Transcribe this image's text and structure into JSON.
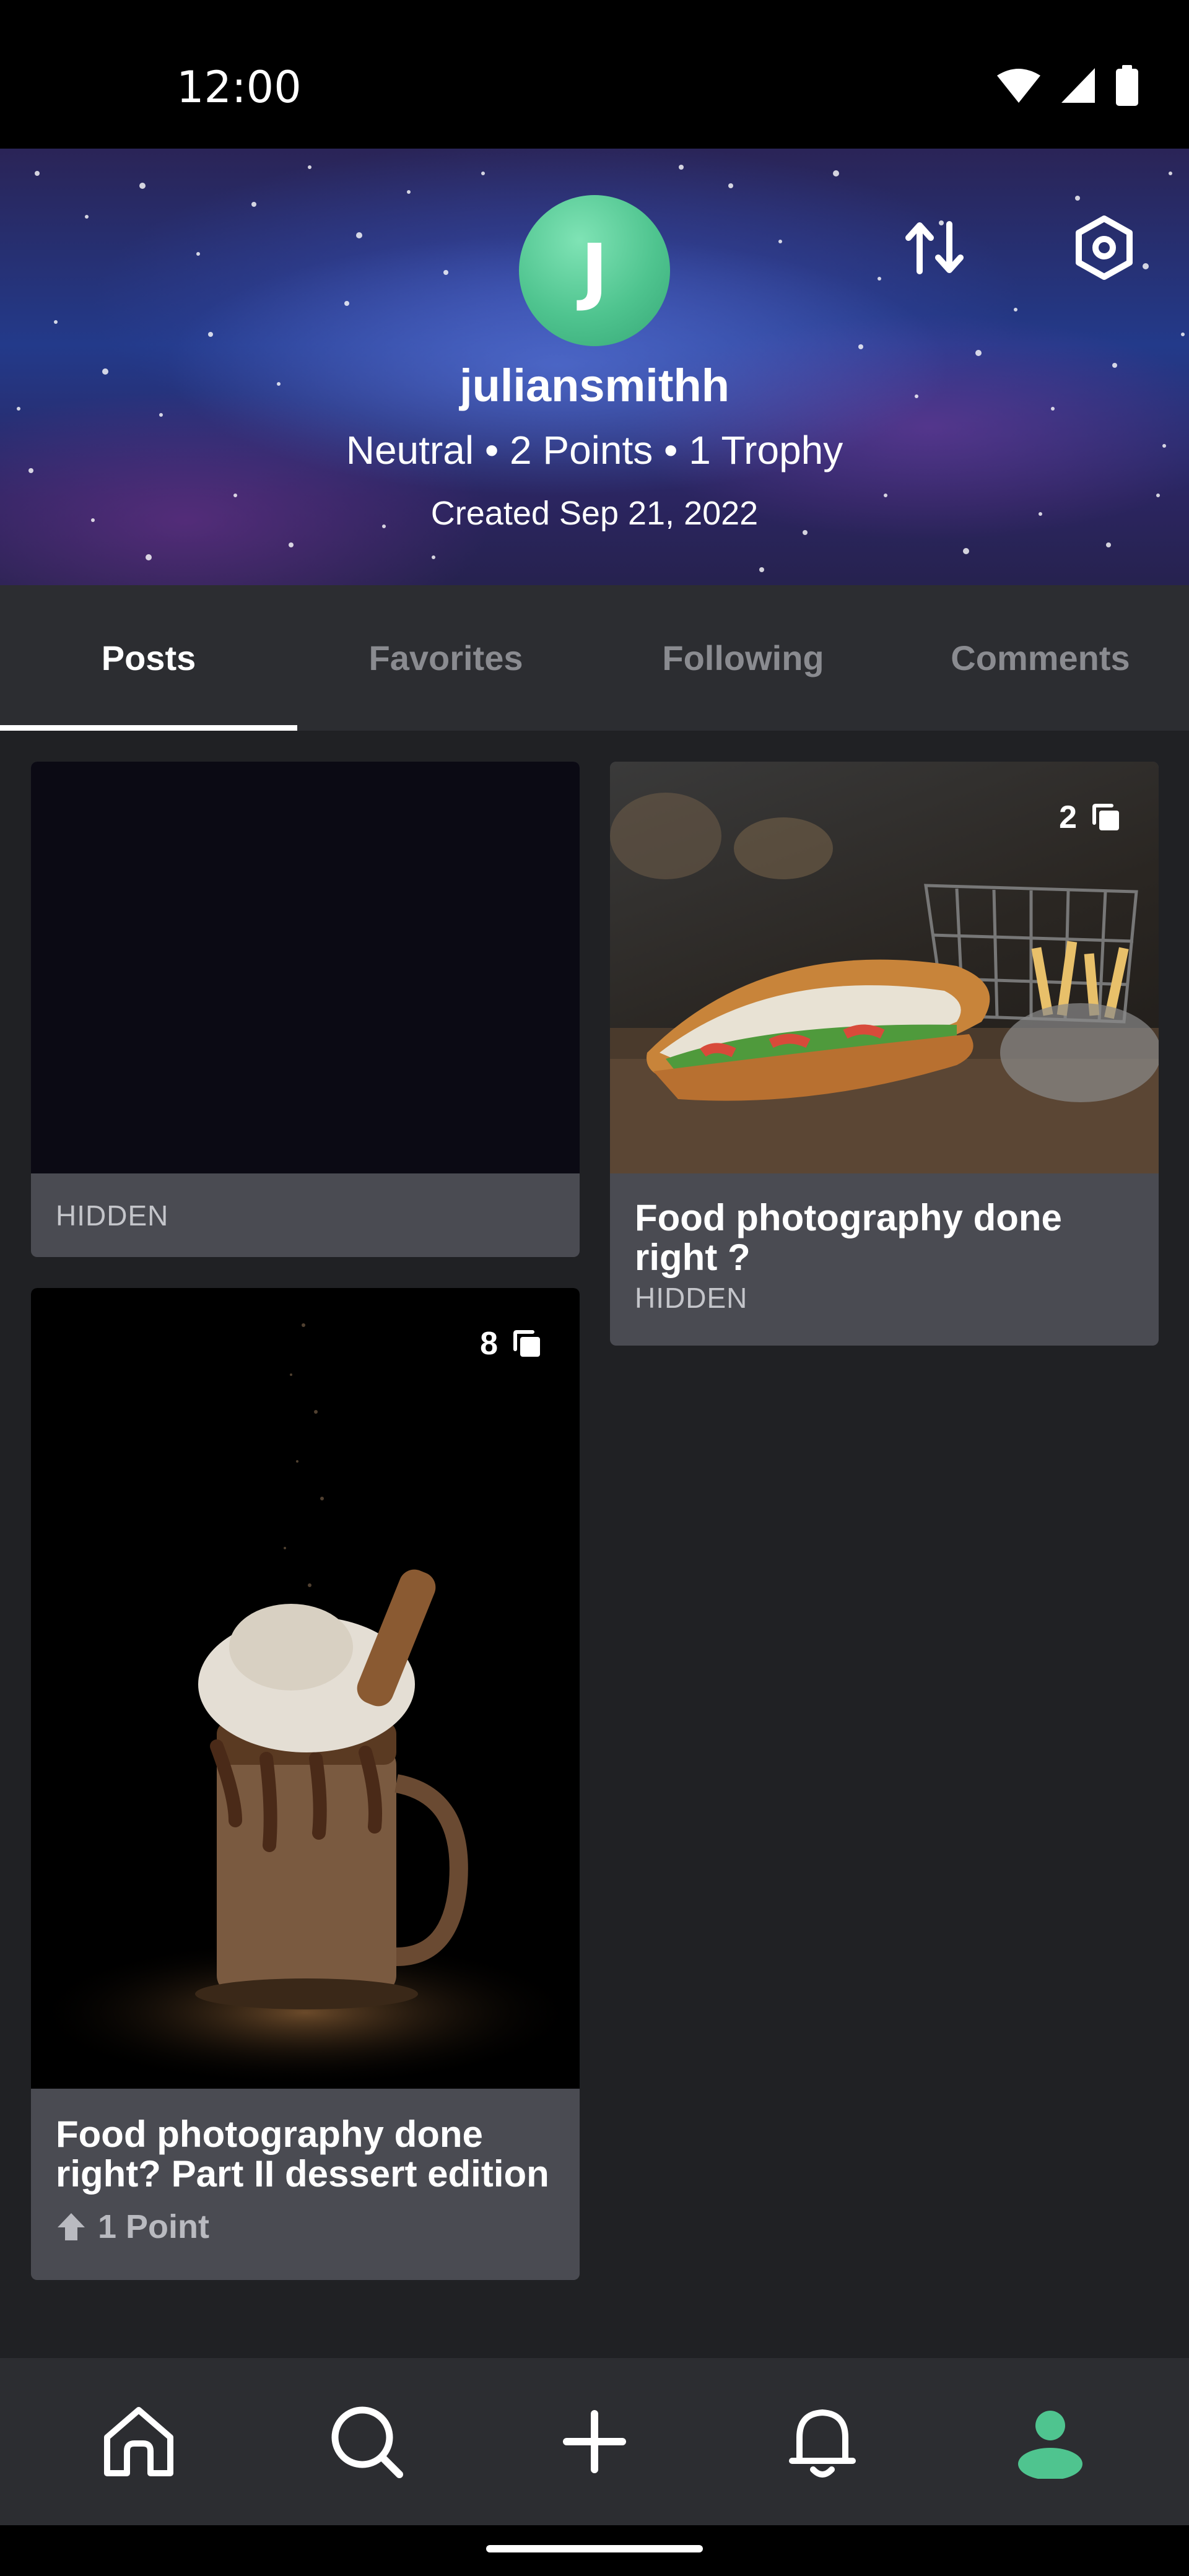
{
  "status_bar": {
    "time": "12:00",
    "icons": [
      "wifi-icon",
      "signal-icon",
      "battery-icon"
    ]
  },
  "profile": {
    "avatar_initial": "J",
    "username": "juliansmithh",
    "stats": "Neutral • 2 Points • 1 Trophy",
    "created": "Created Sep 21, 2022",
    "actions": [
      "sort-icon",
      "settings-icon"
    ]
  },
  "tabs": [
    {
      "label": "Posts",
      "active": true
    },
    {
      "label": "Favorites",
      "active": false
    },
    {
      "label": "Following",
      "active": false
    },
    {
      "label": "Comments",
      "active": false
    }
  ],
  "posts": [
    {
      "title": "",
      "status": "HIDDEN",
      "image": "dark-placeholder"
    },
    {
      "title": "Food photography done right ?",
      "status": "HIDDEN",
      "media_count": "2",
      "image": "sandwich"
    },
    {
      "title": "Food photography done right? Part II dessert edition",
      "points": "1 Point",
      "media_count": "8",
      "image": "milkshake"
    }
  ],
  "bottom_nav": [
    "home-icon",
    "search-icon",
    "add-icon",
    "notifications-icon",
    "profile-icon"
  ],
  "colors": {
    "accent": "#4fc48f",
    "background": "#202124",
    "card": "#4a4b52",
    "tabbar": "#2c2d31"
  }
}
